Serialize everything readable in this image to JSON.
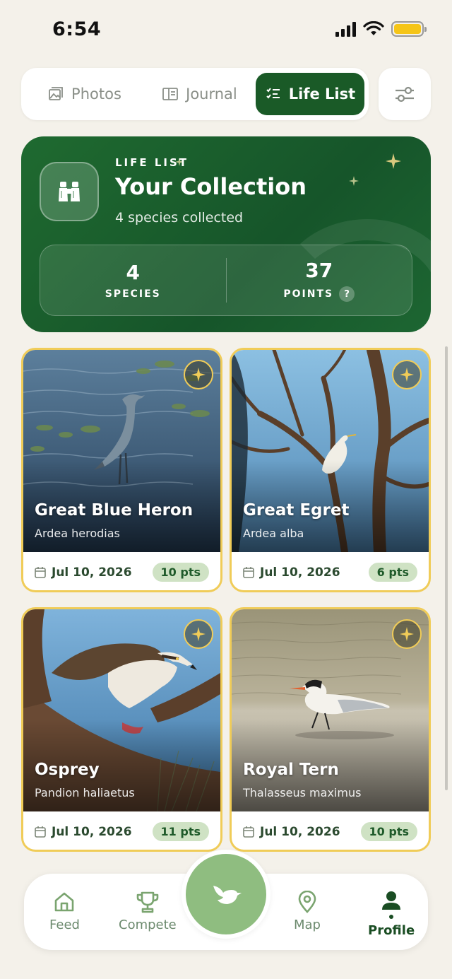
{
  "status_bar": {
    "time": "6:54"
  },
  "tabs": [
    {
      "label": "Photos",
      "icon": "photo-icon",
      "active": false
    },
    {
      "label": "Journal",
      "icon": "journal-icon",
      "active": false
    },
    {
      "label": "Life List",
      "icon": "checklist-icon",
      "active": true
    }
  ],
  "filter_button": {
    "icon": "sliders-icon"
  },
  "hero": {
    "eyebrow": "LIFE LIST",
    "title": "Your Collection",
    "subtitle": "4 species collected",
    "icon": "binoculars-icon",
    "stats": [
      {
        "value": "4",
        "label": "SPECIES"
      },
      {
        "value": "37",
        "label": "POINTS",
        "help": "?"
      }
    ]
  },
  "cards": [
    {
      "name": "Great Blue Heron",
      "scientific": "Ardea herodias",
      "date": "Jul 10, 2026",
      "points": "10 pts"
    },
    {
      "name": "Great Egret",
      "scientific": "Ardea alba",
      "date": "Jul 10, 2026",
      "points": "6 pts"
    },
    {
      "name": "Osprey",
      "scientific": "Pandion haliaetus",
      "date": "Jul 10, 2026",
      "points": "11 pts"
    },
    {
      "name": "Royal Tern",
      "scientific": "Thalasseus maximus",
      "date": "Jul 10, 2026",
      "points": "10 pts"
    }
  ],
  "bottom_nav": [
    {
      "label": "Feed",
      "icon": "home-icon"
    },
    {
      "label": "Compete",
      "icon": "trophy-icon"
    },
    {
      "label": "Map",
      "icon": "map-pin-icon"
    },
    {
      "label": "Profile",
      "icon": "person-icon",
      "active": true
    }
  ],
  "fab": {
    "icon": "bird-icon"
  },
  "colors": {
    "background": "#f4f1ea",
    "primary": "#1a5a27",
    "card_border": "#f0cc58",
    "points_badge": "#cfe2c4",
    "fab": "#8fbd80"
  }
}
